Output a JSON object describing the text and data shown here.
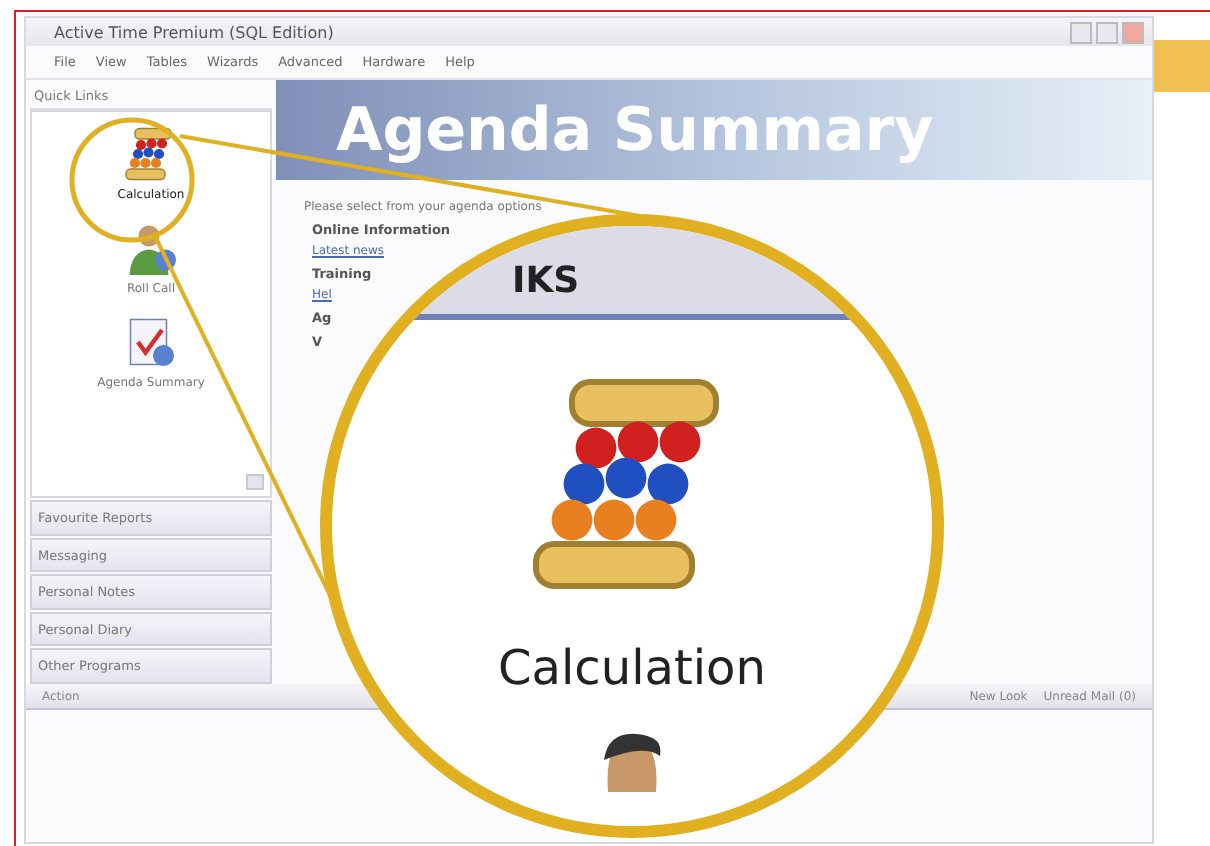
{
  "window": {
    "title": "Active Time Premium (SQL Edition)"
  },
  "menu": [
    "File",
    "View",
    "Tables",
    "Wizards",
    "Advanced",
    "Hardware",
    "Help"
  ],
  "sidebar": {
    "header": "Quick Links",
    "items": [
      {
        "label": "Calculation",
        "kind": "abacus",
        "selected": true
      },
      {
        "label": "Roll Call",
        "kind": "person",
        "selected": false
      },
      {
        "label": "Agenda Summary",
        "kind": "clipboard",
        "selected": false
      }
    ],
    "sections": [
      "Favourite Reports",
      "Messaging",
      "Personal Notes",
      "Personal Diary",
      "Other Programs"
    ]
  },
  "content": {
    "banner": "Agenda Summary",
    "intro": "Please select from your agenda options",
    "groups": [
      {
        "heading": "Online Information",
        "link": "Latest news"
      },
      {
        "heading": "Training",
        "link": "Hel"
      },
      {
        "heading": "Ag"
      },
      {
        "heading": "V"
      }
    ]
  },
  "status_bar": {
    "left": "Action",
    "right": [
      "New Look",
      "Unread Mail (0)"
    ]
  },
  "magnifier": {
    "heading": "IKS",
    "label": "Calculation"
  }
}
